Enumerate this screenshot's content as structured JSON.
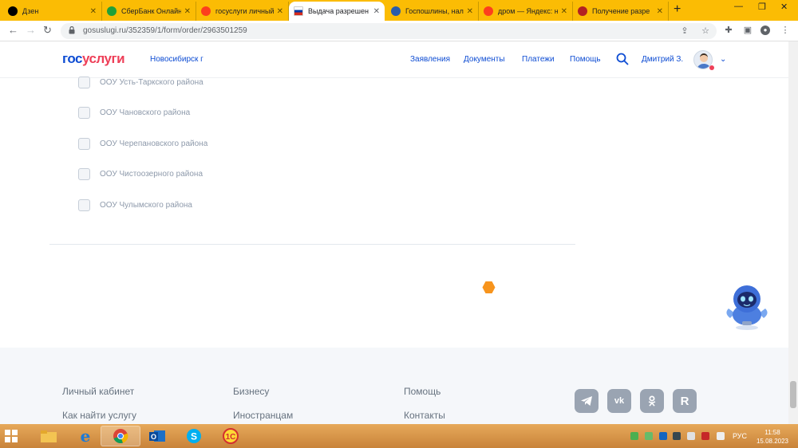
{
  "browser": {
    "tabs": [
      {
        "title": "Дзен"
      },
      {
        "title": "СберБанк Онлайн"
      },
      {
        "title": "госуслуги личный"
      },
      {
        "title": "Выдача разрешен"
      },
      {
        "title": "Госпошлины, нал"
      },
      {
        "title": "дром — Яндекс: н"
      },
      {
        "title": "Получение разре"
      }
    ],
    "active_tab_index": 3,
    "url": "gosuslugi.ru/352359/1/form/order/2963501259"
  },
  "site": {
    "logo_part1": "гос",
    "logo_part2": "услуги",
    "city": "Новосибирск г",
    "nav": [
      "Заявления",
      "Документы",
      "Платежи",
      "Помощь"
    ],
    "user_name": "Дмитрий З.",
    "colors": {
      "brand_blue": "#0d4cd3",
      "brand_red": "#ee3f58",
      "loader": "#f7941d"
    }
  },
  "list": {
    "items": [
      "ООУ Усть-Таркского района",
      "ООУ Чановского района",
      "ООУ Черепановского района",
      "ООУ Чистоозерного района",
      "ООУ Чулымского района"
    ]
  },
  "footer": {
    "col1": [
      "Личный кабинет",
      "Как найти услугу"
    ],
    "col2": [
      "Бизнесу",
      "Иностранцам"
    ],
    "col3": [
      "Помощь",
      "Контакты"
    ],
    "social": [
      "telegram-icon",
      "vk-icon",
      "odnoklassniki-icon",
      "rutube-icon"
    ]
  },
  "taskbar": {
    "lang": "РУС",
    "time": "11:58",
    "date": "15.08.2023"
  }
}
